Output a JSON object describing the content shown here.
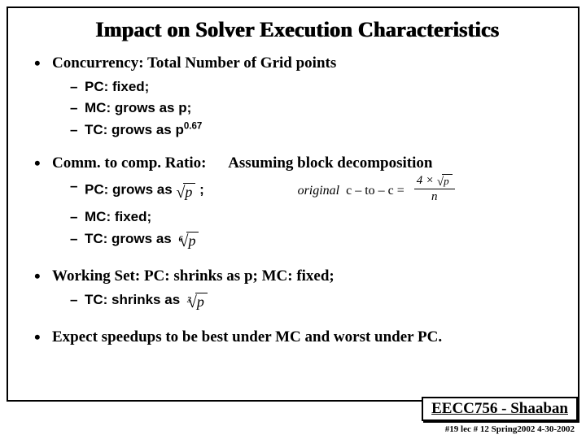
{
  "title": "Impact on Solver Execution Characteristics",
  "bullets": {
    "b1": {
      "head": "Concurrency:  Total Number of Grid points",
      "s1": "PC: fixed;",
      "s2": "MC: grows as p;",
      "s3_a": "TC: grows as p",
      "s3_sup": "0.67"
    },
    "b2": {
      "head": "Comm. to comp. Ratio:",
      "head_extra": "Assuming block decomposition",
      "s1_a": "PC: grows as",
      "s1_rad": "p",
      "s1_b": ";",
      "s2": "MC: fixed;",
      "s3_a": "TC:  grows as",
      "s3_idx": "6",
      "s3_rad": "p",
      "formula_a": "original",
      "formula_b": "c – to – c =",
      "formula_num_pre": "4 ×",
      "formula_num_rad": "p",
      "formula_den": "n"
    },
    "b3": {
      "head": "Working Set:  PC: shrinks as p;  MC: fixed;",
      "s1_a": "TC: shrinks as",
      "s1_idx": "3",
      "s1_rad": "p"
    },
    "b4": {
      "head": "Expect speedups to be best under MC and worst under PC."
    }
  },
  "footer": {
    "course": "EECC756 - Shaaban",
    "line": "#19  lec # 12   Spring2002  4-30-2002"
  }
}
